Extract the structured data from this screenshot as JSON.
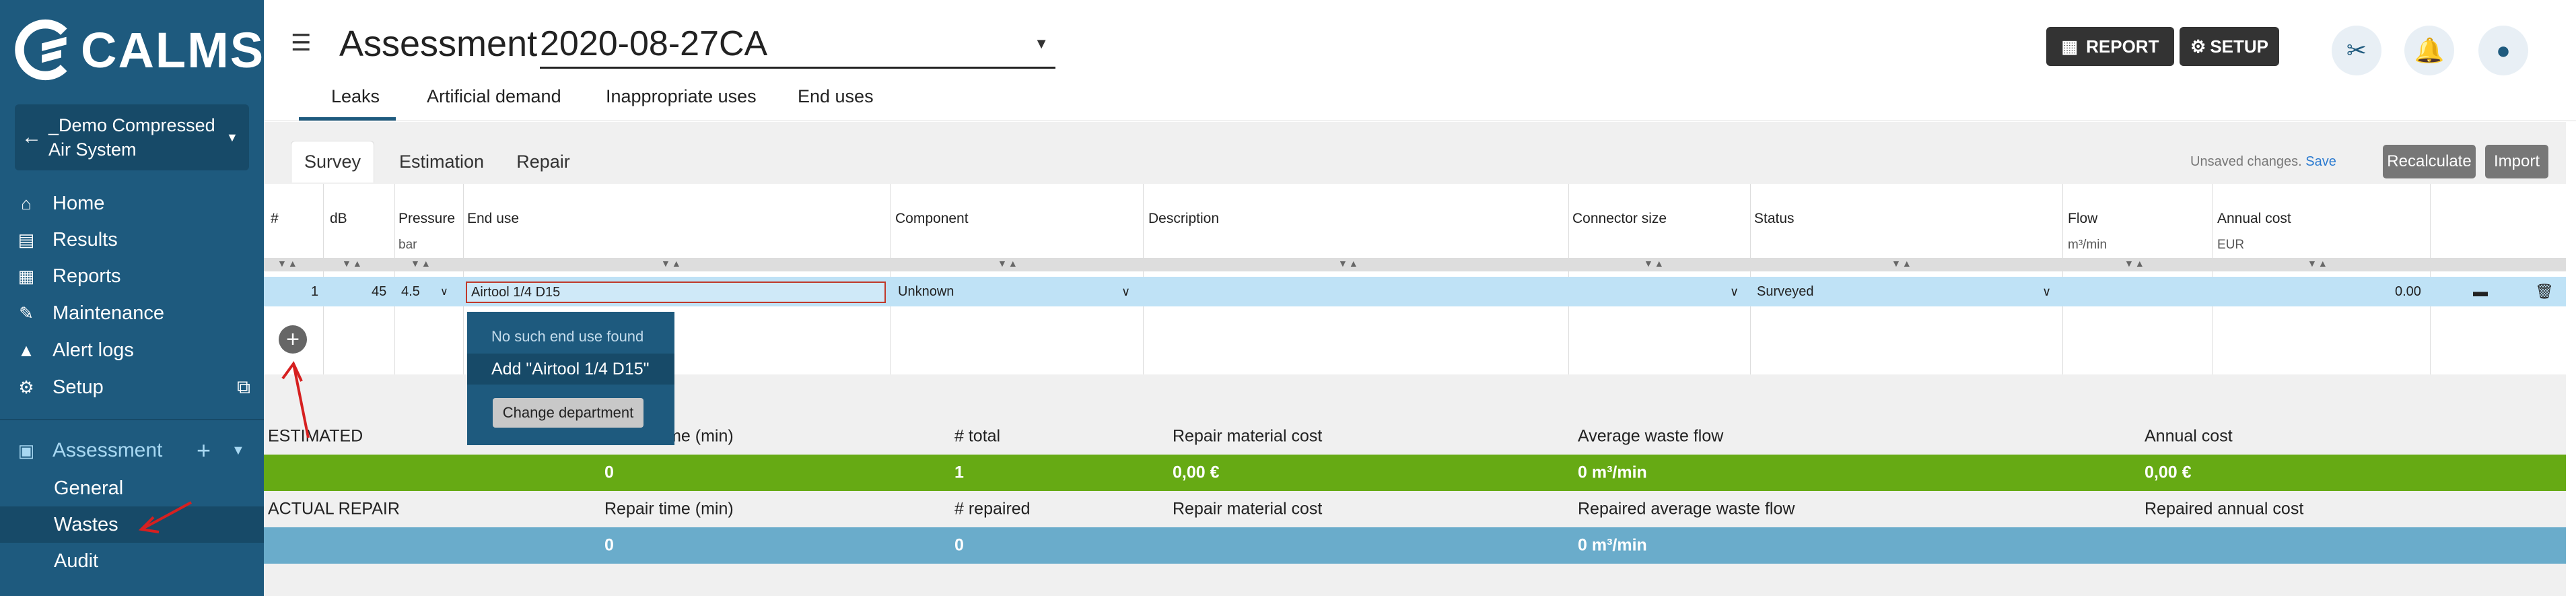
{
  "app": {
    "brand": "CALMS"
  },
  "sidebar": {
    "system": "_Demo Compressed Air System",
    "nav": [
      {
        "label": "Home",
        "icon": "home-icon"
      },
      {
        "label": "Results",
        "icon": "document-icon"
      },
      {
        "label": "Reports",
        "icon": "report-icon"
      },
      {
        "label": "Maintenance",
        "icon": "wrench-icon"
      },
      {
        "label": "Alert logs",
        "icon": "warning-icon"
      },
      {
        "label": "Setup",
        "icon": "gear-icon"
      }
    ],
    "section": "Assessment",
    "sub": [
      "General",
      "Wastes",
      "Audit"
    ]
  },
  "header": {
    "title": "Assessment",
    "assessment": "2020-08-27CA",
    "report_label": "REPORT",
    "setup_label": "SETUP",
    "tabs": [
      "Leaks",
      "Artificial demand",
      "Inappropriate uses",
      "End uses"
    ]
  },
  "content": {
    "subtabs": [
      "Survey",
      "Estimation",
      "Repair"
    ],
    "unsaved": "Unsaved changes.",
    "save": "Save",
    "recalculate": "Recalculate",
    "import": "Import"
  },
  "table": {
    "headers": [
      "#",
      "dB",
      "Pressure",
      "End use",
      "Component",
      "Description",
      "Connector size",
      "Status",
      "Flow",
      "Annual cost"
    ],
    "units": {
      "pressure": "bar",
      "flow": "m³/min",
      "annual_cost": "EUR"
    },
    "row": {
      "num": "1",
      "db": "45",
      "pressure": "4.5",
      "end_use": "Airtool 1/4 D15",
      "component": "Unknown",
      "description": "",
      "connector": "",
      "status": "Surveyed",
      "flow": "",
      "annual_cost": "0.00"
    }
  },
  "dropdown": {
    "not_found": "No such end use found",
    "add": "Add \"Airtool 1/4 D15\"",
    "change_dept": "Change department"
  },
  "summary": {
    "estimated": {
      "label": "ESTIMATED",
      "cols": [
        "Repair time (min)",
        "# total",
        "Repair material cost",
        "Average waste flow",
        "Annual cost"
      ],
      "vals": [
        "0",
        "1",
        "0,00 €",
        "0 m³/min",
        "0,00 €"
      ]
    },
    "actual": {
      "label": "ACTUAL REPAIR",
      "cols": [
        "Repair time (min)",
        "# repaired",
        "Repair material cost",
        "Repaired average waste flow",
        "Repaired annual cost"
      ],
      "vals": [
        "0",
        "0",
        "",
        "0 m³/min",
        ""
      ]
    }
  },
  "colors": {
    "sidebar": "#1e5a7e",
    "estimated": "#66aa14",
    "actual": "#6aaccb"
  }
}
